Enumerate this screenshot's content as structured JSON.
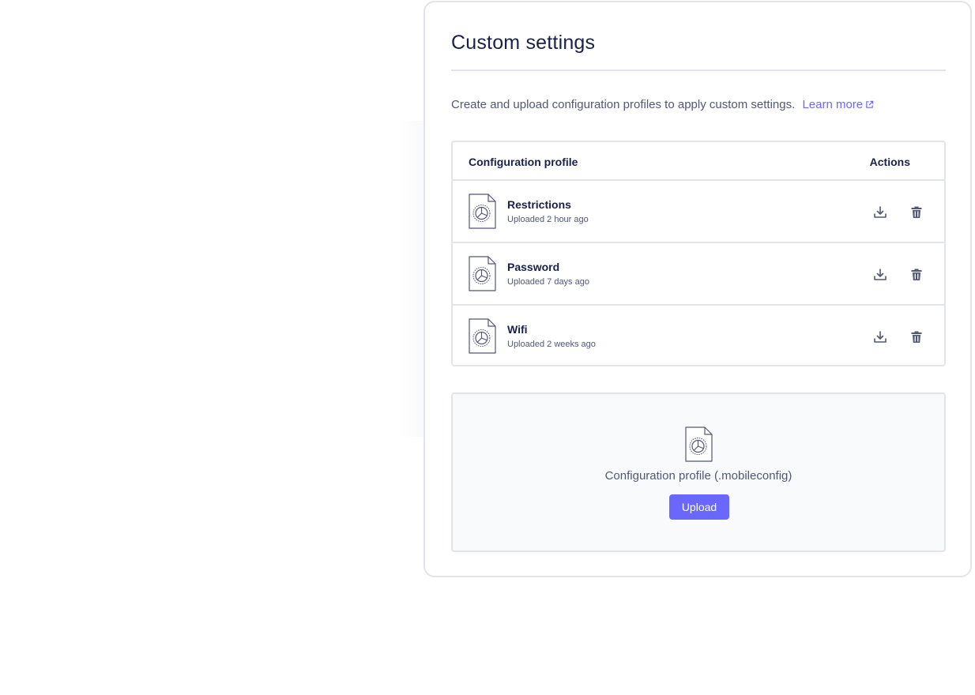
{
  "card": {
    "title": "Custom settings",
    "description": "Create and upload configuration profiles to apply custom settings.",
    "learn_more": "Learn more"
  },
  "table": {
    "headers": {
      "profile": "Configuration profile",
      "actions": "Actions"
    },
    "rows": [
      {
        "name": "Restrictions",
        "uploaded": "Uploaded 2 hour ago"
      },
      {
        "name": "Password",
        "uploaded": "Uploaded 7 days ago"
      },
      {
        "name": "Wifi",
        "uploaded": "Uploaded 2 weeks ago"
      }
    ],
    "row_icons": [
      "config-profile-file-icon",
      "download-icon",
      "trash-icon"
    ]
  },
  "upload": {
    "label": "Configuration profile (.mobileconfig)",
    "button_label": "Upload",
    "icon": "config-profile-file-icon"
  },
  "colors": {
    "accent": "#6a67fe",
    "text_primary": "#192147",
    "text_secondary": "#515774",
    "border": "#e2e4ea",
    "upload_bg": "#f9fafc"
  }
}
